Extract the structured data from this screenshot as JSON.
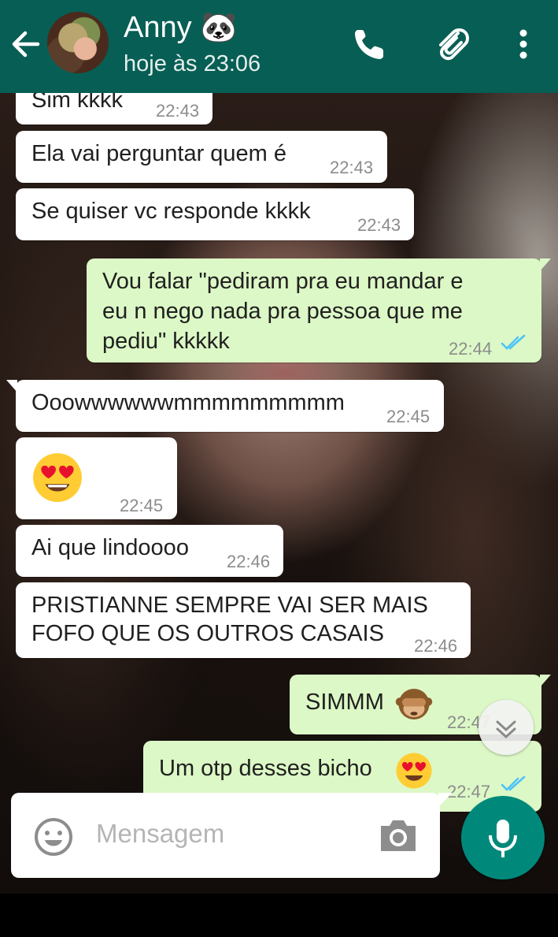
{
  "header": {
    "contact_name": "Anny 🐼",
    "status": "hoje às 23:06"
  },
  "messages": [
    {
      "dir": "in",
      "text": "Sim kkkk",
      "time": "22:43"
    },
    {
      "dir": "in",
      "text": "Ela vai perguntar quem é",
      "time": "22:43"
    },
    {
      "dir": "in",
      "text": "Se quiser vc responde kkkk",
      "time": "22:43"
    },
    {
      "dir": "out",
      "lines": [
        "Vou falar \"pediram pra eu mandar e",
        "eu n nego nada pra pessoa que me",
        "pediu\" kkkkk"
      ],
      "time": "22:44",
      "status": "read"
    },
    {
      "dir": "in",
      "text": "Ooowwwwwwmmmmmmmmm",
      "time": "22:45"
    },
    {
      "dir": "in",
      "emoji": "heart-eyes",
      "time": "22:45"
    },
    {
      "dir": "in",
      "text": "Ai que lindoooo",
      "time": "22:46"
    },
    {
      "dir": "in",
      "lines": [
        "PRISTIANNE SEMPRE VAI SER MAIS",
        "FOFO QUE OS OUTROS CASAIS"
      ],
      "time": "22:46"
    },
    {
      "dir": "out",
      "text": "SIMMM",
      "emoji": "see-no-evil-monkey",
      "time": "22:47",
      "status": "read"
    },
    {
      "dir": "out",
      "text": "Um otp desses bicho",
      "emoji": "heart-eyes",
      "time": "22:47",
      "status": "read"
    }
  ],
  "input": {
    "placeholder": "Mensagem"
  },
  "icons": {
    "back": "arrow-left-icon",
    "call": "phone-icon",
    "attach": "paperclip-icon",
    "more": "more-vertical-icon",
    "emoji": "emoji-icon",
    "camera": "camera-icon",
    "mic": "mic-icon",
    "scroll": "chevron-double-down-icon"
  },
  "colors": {
    "header": "#075e54",
    "incoming_bubble": "#ffffff",
    "outgoing_bubble": "#dcf8c6",
    "read_ticks": "#4fc3f7",
    "mic_button": "#00897b"
  }
}
